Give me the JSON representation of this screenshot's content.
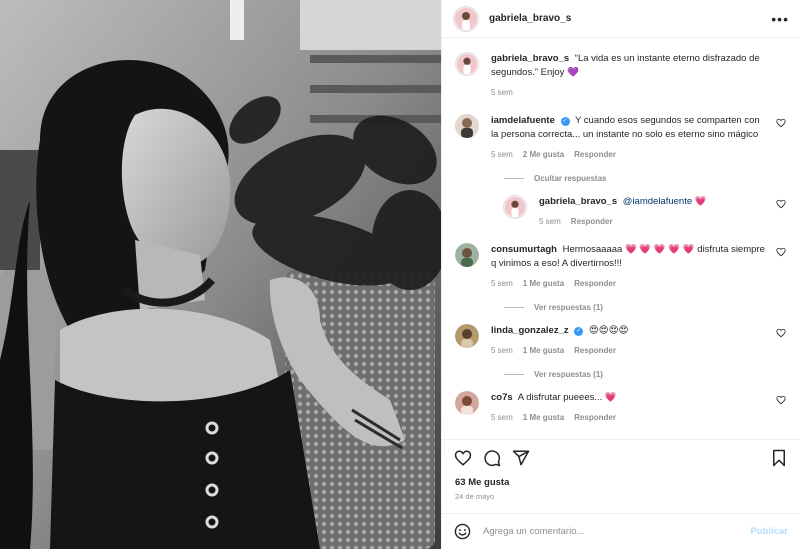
{
  "post": {
    "author": "gabriela_bravo_s",
    "more_icon": "more-horizontal-icon",
    "caption": "“La vida es un instante eterno disfrazado de segundos.” Enjoy",
    "caption_emoji": "💜",
    "caption_time": "5 sem"
  },
  "comments": [
    {
      "user": "iamdelafuente",
      "verified": true,
      "text": "Y cuando esos segundos se comparten con la persona correcta... un instante no solo es eterno sino mágico",
      "time": "5 sem",
      "likes": "2 Me gusta",
      "reply_label": "Responder",
      "replies_toggle": "Ocultar respuestas",
      "replies": [
        {
          "user": "gabriela_bravo_s",
          "mention": "@iamdelafuente",
          "emoji": "💗",
          "time": "5 sem",
          "reply_label": "Responder"
        }
      ]
    },
    {
      "user": "consumurtagh",
      "text": "Hermosaaaaa",
      "emoji": "💗 💗 💗 💗 💗",
      "text2": "disfruta siempre q vinimos a eso! A divertirnos!!!",
      "time": "5 sem",
      "likes": "1 Me gusta",
      "reply_label": "Responder",
      "replies_toggle": "Ver respuestas (1)"
    },
    {
      "user": "linda_gonzalez_z",
      "verified": true,
      "emoji": "😍😍😍😍",
      "time": "5 sem",
      "likes": "1 Me gusta",
      "reply_label": "Responder",
      "replies_toggle": "Ver respuestas (1)"
    },
    {
      "user": "co7s",
      "text": "A disfrutar pueees...",
      "emoji": "💗",
      "time": "5 sem",
      "likes": "1 Me gusta",
      "reply_label": "Responder"
    }
  ],
  "actions": {
    "like_icon": "heart-icon",
    "comment_icon": "comment-icon",
    "share_icon": "send-icon",
    "save_icon": "bookmark-icon"
  },
  "likes_count": "63 Me gusta",
  "date": "24 de mayo",
  "add_comment": {
    "placeholder": "Agrega un comentario...",
    "publish_label": "Publicar",
    "emoji_icon": "smiley-icon"
  },
  "colors": {
    "link_blue": "#00376b",
    "verified_blue": "#3897f0",
    "publish_disabled": "#b2dffc",
    "heart_red": "#ed4956",
    "muted_gray": "#8e8e8e"
  }
}
